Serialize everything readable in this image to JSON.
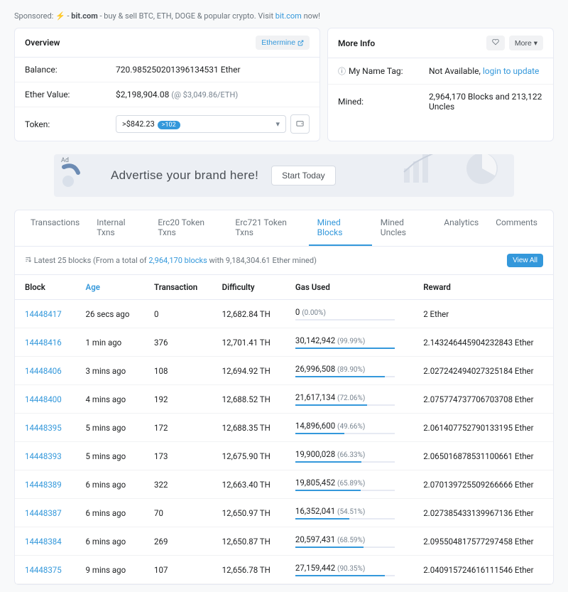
{
  "sponsored": {
    "prefix": "Sponsored:",
    "site": "bit.com",
    "text": "- buy & sell BTC, ETH, DOGE & popular crypto. Visit",
    "link": "bit.com",
    "suffix": "now!"
  },
  "overview": {
    "title": "Overview",
    "pool_btn": "Ethermine",
    "balance_label": "Balance:",
    "balance_value": "720.985250201396134531 Ether",
    "ethervalue_label": "Ether Value:",
    "ethervalue_value": "$2,198,904.08",
    "ethervalue_rate": "(@ $3,049.86/ETH)",
    "token_label": "Token:",
    "token_value": ">$842.23",
    "token_badge": ">102"
  },
  "moreinfo": {
    "title": "More Info",
    "more_btn": "More",
    "nametag_label": "My Name Tag:",
    "nametag_na": "Not Available,",
    "nametag_link": "login to update",
    "mined_label": "Mined:",
    "mined_value": "2,964,170 Blocks and 213,122 Uncles"
  },
  "ad": {
    "label": "Ad",
    "title": "Advertise your brand here!",
    "cta": "Start Today"
  },
  "tabs": [
    "Transactions",
    "Internal Txns",
    "Erc20 Token Txns",
    "Erc721 Token Txns",
    "Mined Blocks",
    "Mined Uncles",
    "Analytics",
    "Comments"
  ],
  "active_tab": 4,
  "summary": {
    "prefix": "Latest 25 blocks (From a total of",
    "link": "2,964,170 blocks",
    "suffix": "with 9,184,304.61 Ether mined)"
  },
  "viewall": "View All",
  "columns": [
    "Block",
    "Age",
    "Transaction",
    "Difficulty",
    "Gas Used",
    "Reward"
  ],
  "rows": [
    {
      "block": "14448417",
      "age": "26 secs ago",
      "txn": "0",
      "diff": "12,682.84 TH",
      "gas": "0",
      "pct": "0.00%",
      "pctn": 0,
      "reward": "2 Ether"
    },
    {
      "block": "14448416",
      "age": "1 min ago",
      "txn": "376",
      "diff": "12,701.41 TH",
      "gas": "30,142,942",
      "pct": "99.99%",
      "pctn": 99.99,
      "reward": "2.143246445904232843 Ether"
    },
    {
      "block": "14448406",
      "age": "3 mins ago",
      "txn": "108",
      "diff": "12,694.92 TH",
      "gas": "26,996,508",
      "pct": "89.90%",
      "pctn": 89.9,
      "reward": "2.027242494027325184 Ether"
    },
    {
      "block": "14448400",
      "age": "4 mins ago",
      "txn": "192",
      "diff": "12,688.52 TH",
      "gas": "21,617,134",
      "pct": "72.06%",
      "pctn": 72.06,
      "reward": "2.075774737706703708 Ether"
    },
    {
      "block": "14448395",
      "age": "5 mins ago",
      "txn": "172",
      "diff": "12,688.35 TH",
      "gas": "14,896,600",
      "pct": "49.66%",
      "pctn": 49.66,
      "reward": "2.061407752790133195 Ether"
    },
    {
      "block": "14448393",
      "age": "5 mins ago",
      "txn": "173",
      "diff": "12,675.90 TH",
      "gas": "19,900,028",
      "pct": "66.33%",
      "pctn": 66.33,
      "reward": "2.065016878531100661 Ether"
    },
    {
      "block": "14448389",
      "age": "6 mins ago",
      "txn": "322",
      "diff": "12,663.40 TH",
      "gas": "19,805,452",
      "pct": "65.89%",
      "pctn": 65.89,
      "reward": "2.070139725509266666 Ether"
    },
    {
      "block": "14448387",
      "age": "6 mins ago",
      "txn": "70",
      "diff": "12,650.97 TH",
      "gas": "16,352,041",
      "pct": "54.51%",
      "pctn": 54.51,
      "reward": "2.027385433139967136 Ether"
    },
    {
      "block": "14448384",
      "age": "6 mins ago",
      "txn": "269",
      "diff": "12,650.87 TH",
      "gas": "20,597,431",
      "pct": "68.59%",
      "pctn": 68.59,
      "reward": "2.095504817577297458 Ether"
    },
    {
      "block": "14448375",
      "age": "9 mins ago",
      "txn": "107",
      "diff": "12,656.78 TH",
      "gas": "27,159,442",
      "pct": "90.35%",
      "pctn": 90.35,
      "reward": "2.040915724616111546 Ether"
    }
  ]
}
